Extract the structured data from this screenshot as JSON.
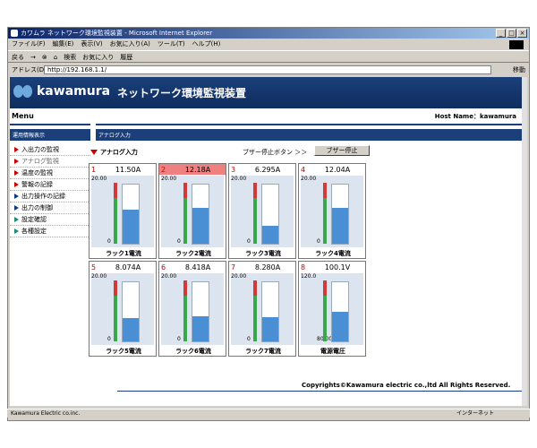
{
  "window": {
    "title": "カワムラ ネットワーク環境監視装置 - Microsoft Internet Explorer"
  },
  "menubar": [
    "ファイル(F)",
    "編集(E)",
    "表示(V)",
    "お気に入り(A)",
    "ツール(T)",
    "ヘルプ(H)"
  ],
  "toolbar": [
    "戻る",
    "→",
    "⊗",
    "⌂",
    "検索",
    "お気に入り",
    "履歴"
  ],
  "address": {
    "label": "アドレス(D)",
    "url": "http://192.168.1.1/",
    "go": "移動"
  },
  "header": {
    "logo": "kawamura",
    "title": "ネットワーク環境監視装置"
  },
  "subheader": {
    "menu": "Menu",
    "host_label": "Host Name：",
    "host_value": "kawamura"
  },
  "sidebar": {
    "title": "運用情報表示",
    "items": [
      {
        "label": "入出力の監視"
      },
      {
        "label": "アナログ監視"
      },
      {
        "label": "温度の監視"
      },
      {
        "label": "警報の記録"
      },
      {
        "label": "出力操作の記録"
      },
      {
        "label": "出力の制御"
      },
      {
        "label": "設定確認"
      },
      {
        "label": "各種設定"
      }
    ]
  },
  "main": {
    "panel_title": "アナログ入力",
    "section_title": "アナログ入力",
    "buzzer_text": "ブザー停止ボタン ＞＞",
    "buzzer_button": "ブザー停止",
    "tiles": [
      {
        "no": "1",
        "value": "11.50A",
        "top": "20.00",
        "bottom": "0",
        "label": "ラック1電流",
        "fill": 0.58,
        "alarm": false
      },
      {
        "no": "2",
        "value": "12.18A",
        "top": "20.00",
        "bottom": "0",
        "label": "ラック2電流",
        "fill": 0.61,
        "alarm": true
      },
      {
        "no": "3",
        "value": "6.295A",
        "top": "20.00",
        "bottom": "0",
        "label": "ラック3電流",
        "fill": 0.31,
        "alarm": false
      },
      {
        "no": "4",
        "value": "12.04A",
        "top": "20.00",
        "bottom": "0",
        "label": "ラック4電流",
        "fill": 0.6,
        "alarm": false
      },
      {
        "no": "5",
        "value": "8.074A",
        "top": "20.00",
        "bottom": "0",
        "label": "ラック5電流",
        "fill": 0.4,
        "alarm": false
      },
      {
        "no": "6",
        "value": "8.418A",
        "top": "20.00",
        "bottom": "0",
        "label": "ラック6電流",
        "fill": 0.42,
        "alarm": false
      },
      {
        "no": "7",
        "value": "8.280A",
        "top": "20.00",
        "bottom": "0",
        "label": "ラック7電流",
        "fill": 0.41,
        "alarm": false
      },
      {
        "no": "8",
        "value": "100.1V",
        "top": "120.0",
        "bottom": "80.00",
        "label": "電源電圧",
        "fill": 0.5,
        "alarm": false
      }
    ]
  },
  "footer": {
    "copyright": "Copyrights©Kawamura electric co.,ltd All Rights Reserved."
  },
  "status": {
    "left": "Kawamura Electric co.inc.",
    "right": "インターネット"
  }
}
